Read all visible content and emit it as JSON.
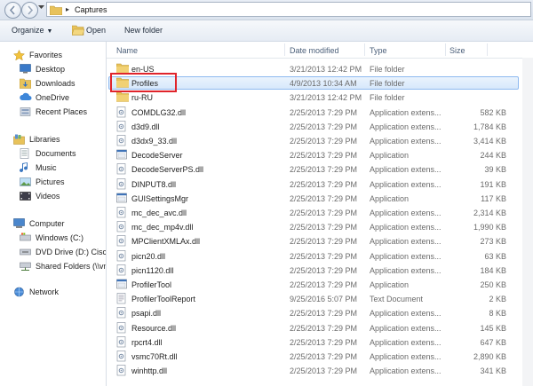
{
  "address": {
    "path": "Captures"
  },
  "toolbar": {
    "organize": "Organize",
    "open": "Open",
    "new_folder": "New folder"
  },
  "nav": {
    "favorites": "Favorites",
    "favorites_items": [
      "Desktop",
      "Downloads",
      "OneDrive",
      "Recent Places"
    ],
    "libraries": "Libraries",
    "libraries_items": [
      "Documents",
      "Music",
      "Pictures",
      "Videos"
    ],
    "computer": "Computer",
    "computer_items": [
      "Windows (C:)",
      "DVD Drive (D:) Cisco",
      "Shared Folders (\\\\vn"
    ],
    "network": "Network"
  },
  "columns": {
    "name": "Name",
    "date": "Date modified",
    "type": "Type",
    "size": "Size"
  },
  "files": [
    {
      "name": "en-US",
      "date": "3/21/2013 12:42 PM",
      "type": "File folder",
      "size": "",
      "icon": "folder-icon"
    },
    {
      "name": "Profiles",
      "date": "4/9/2013 10:34 AM",
      "type": "File folder",
      "size": "",
      "icon": "folder-icon"
    },
    {
      "name": "ru-RU",
      "date": "3/21/2013 12:42 PM",
      "type": "File folder",
      "size": "",
      "icon": "folder-icon"
    },
    {
      "name": "COMDLG32.dll",
      "date": "2/25/2013 7:29 PM",
      "type": "Application extens...",
      "size": "582 KB",
      "icon": "dll-icon"
    },
    {
      "name": "d3d9.dll",
      "date": "2/25/2013 7:29 PM",
      "type": "Application extens...",
      "size": "1,784 KB",
      "icon": "dll-icon"
    },
    {
      "name": "d3dx9_33.dll",
      "date": "2/25/2013 7:29 PM",
      "type": "Application extens...",
      "size": "3,414 KB",
      "icon": "dll-icon"
    },
    {
      "name": "DecodeServer",
      "date": "2/25/2013 7:29 PM",
      "type": "Application",
      "size": "244 KB",
      "icon": "exe-icon"
    },
    {
      "name": "DecodeServerPS.dll",
      "date": "2/25/2013 7:29 PM",
      "type": "Application extens...",
      "size": "39 KB",
      "icon": "dll-icon"
    },
    {
      "name": "DINPUT8.dll",
      "date": "2/25/2013 7:29 PM",
      "type": "Application extens...",
      "size": "191 KB",
      "icon": "dll-icon"
    },
    {
      "name": "GUISettingsMgr",
      "date": "2/25/2013 7:29 PM",
      "type": "Application",
      "size": "117 KB",
      "icon": "exe-icon"
    },
    {
      "name": "mc_dec_avc.dll",
      "date": "2/25/2013 7:29 PM",
      "type": "Application extens...",
      "size": "2,314 KB",
      "icon": "dll-icon"
    },
    {
      "name": "mc_dec_mp4v.dll",
      "date": "2/25/2013 7:29 PM",
      "type": "Application extens...",
      "size": "1,990 KB",
      "icon": "dll-icon"
    },
    {
      "name": "MPClientXMLAx.dll",
      "date": "2/25/2013 7:29 PM",
      "type": "Application extens...",
      "size": "273 KB",
      "icon": "dll-icon"
    },
    {
      "name": "picn20.dll",
      "date": "2/25/2013 7:29 PM",
      "type": "Application extens...",
      "size": "63 KB",
      "icon": "dll-icon"
    },
    {
      "name": "picn1120.dll",
      "date": "2/25/2013 7:29 PM",
      "type": "Application extens...",
      "size": "184 KB",
      "icon": "dll-icon"
    },
    {
      "name": "ProfilerTool",
      "date": "2/25/2013 7:29 PM",
      "type": "Application",
      "size": "250 KB",
      "icon": "exe-icon"
    },
    {
      "name": "ProfilerToolReport",
      "date": "9/25/2016 5:07 PM",
      "type": "Text Document",
      "size": "2 KB",
      "icon": "text-doc-icon"
    },
    {
      "name": "psapi.dll",
      "date": "2/25/2013 7:29 PM",
      "type": "Application extens...",
      "size": "8 KB",
      "icon": "dll-icon"
    },
    {
      "name": "Resource.dll",
      "date": "2/25/2013 7:29 PM",
      "type": "Application extens...",
      "size": "145 KB",
      "icon": "dll-icon"
    },
    {
      "name": "rpcrt4.dll",
      "date": "2/25/2013 7:29 PM",
      "type": "Application extens...",
      "size": "647 KB",
      "icon": "dll-icon"
    },
    {
      "name": "vsmc70Rt.dll",
      "date": "2/25/2013 7:29 PM",
      "type": "Application extens...",
      "size": "2,890 KB",
      "icon": "dll-icon"
    },
    {
      "name": "winhttp.dll",
      "date": "2/25/2013 7:29 PM",
      "type": "Application extens...",
      "size": "341 KB",
      "icon": "dll-icon"
    }
  ],
  "selected_file": "Profiles",
  "colors": {
    "selection": "#d7e8fb",
    "highlight_box": "#e0242b",
    "folder": "#e8c25a"
  }
}
